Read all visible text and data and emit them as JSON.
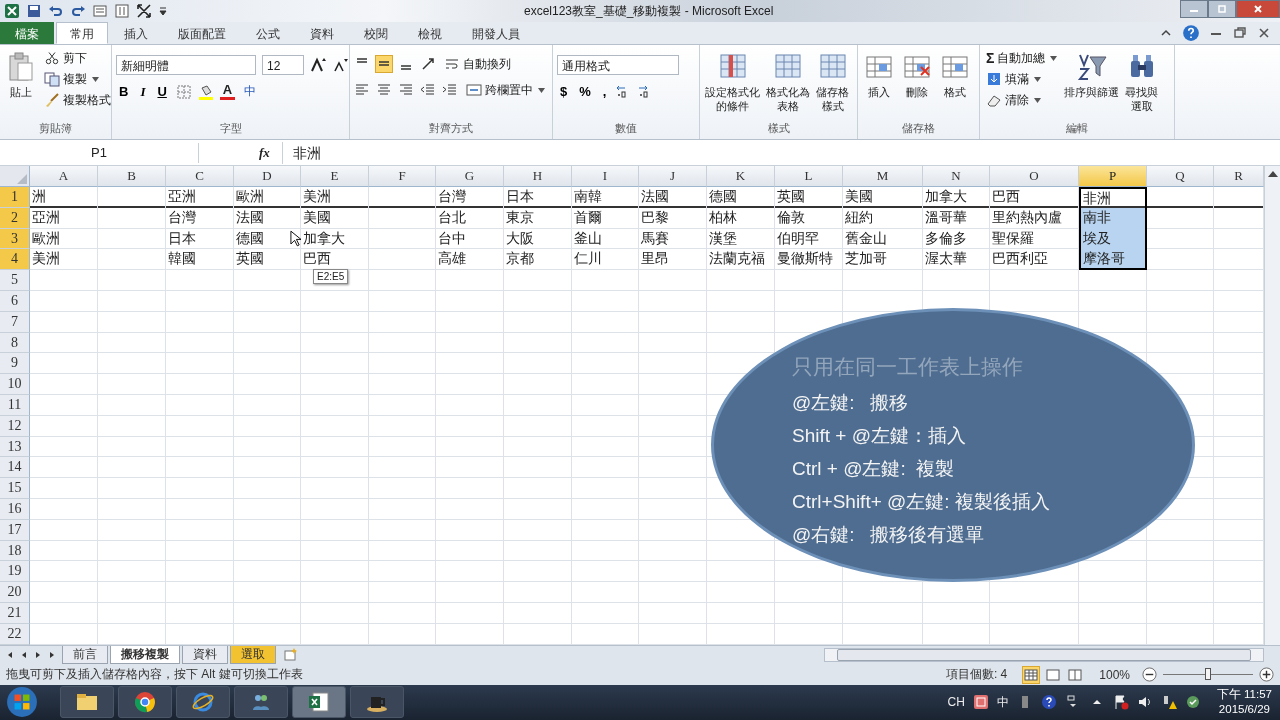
{
  "window": {
    "title": "excel123教室_基礎_移動複製 - Microsoft Excel"
  },
  "ribbon_tabs": [
    {
      "label": "檔案",
      "kind": "file",
      "selected": false
    },
    {
      "label": "常用",
      "kind": "tab",
      "selected": true
    },
    {
      "label": "插入",
      "kind": "tab",
      "selected": false
    },
    {
      "label": "版面配置",
      "kind": "tab",
      "selected": false
    },
    {
      "label": "公式",
      "kind": "tab",
      "selected": false
    },
    {
      "label": "資料",
      "kind": "tab",
      "selected": false
    },
    {
      "label": "校閱",
      "kind": "tab",
      "selected": false
    },
    {
      "label": "檢視",
      "kind": "tab",
      "selected": false
    },
    {
      "label": "開發人員",
      "kind": "tab",
      "selected": false
    }
  ],
  "ribbon": {
    "clipboard": {
      "label": "剪貼簿",
      "paste": "貼上",
      "cut": "剪下",
      "copy": "複製",
      "format_painter": "複製格式"
    },
    "font": {
      "label": "字型",
      "font_name": "新細明體",
      "font_size": "12",
      "bold": "B",
      "italic": "I",
      "underline": "U",
      "font_color": "A",
      "phonetic": "中"
    },
    "alignment": {
      "label": "對齊方式",
      "vertical": [
        {
          "selected": false
        },
        {
          "selected": true
        },
        {
          "selected": false
        }
      ],
      "wrap": "自動換列",
      "merge": "跨欄置中"
    },
    "number": {
      "label": "數值",
      "format": "通用格式",
      "currency": "$",
      "percent": "%",
      "comma": ","
    },
    "styles": {
      "label": "樣式",
      "buttons": [
        {
          "lines": [
            "設定格式化",
            "的條件"
          ]
        },
        {
          "lines": [
            "格式化為",
            "表格"
          ]
        },
        {
          "lines": [
            "儲存格",
            "樣式"
          ]
        }
      ]
    },
    "cells": {
      "label": "儲存格",
      "buttons": [
        "插入",
        "刪除",
        "格式"
      ]
    },
    "editing": {
      "label": "編輯",
      "sum_symbol": "Σ",
      "autosum": "自動加總",
      "fill": "填滿",
      "clear": "清除",
      "sort": "排序與篩選",
      "find": [
        "尋找與",
        "選取"
      ]
    }
  },
  "formula_bar": {
    "name_box": "P1",
    "fx": "fx",
    "formula": "非洲"
  },
  "grid": {
    "columns": [
      {
        "label": "A",
        "selected": false
      },
      {
        "label": "B",
        "selected": false
      },
      {
        "label": "C",
        "selected": false
      },
      {
        "label": "D",
        "selected": false
      },
      {
        "label": "E",
        "selected": false
      },
      {
        "label": "F",
        "selected": false
      },
      {
        "label": "G",
        "selected": false
      },
      {
        "label": "H",
        "selected": false
      },
      {
        "label": "I",
        "selected": false
      },
      {
        "label": "J",
        "selected": false
      },
      {
        "label": "K",
        "selected": false
      },
      {
        "label": "L",
        "selected": false
      },
      {
        "label": "M",
        "selected": false
      },
      {
        "label": "N",
        "selected": false
      },
      {
        "label": "O",
        "selected": false
      },
      {
        "label": "P",
        "selected": true
      },
      {
        "label": "Q",
        "selected": false
      },
      {
        "label": "R",
        "selected": false
      }
    ],
    "rows": [
      {
        "number": "1",
        "selected": true,
        "cells": [
          {
            "text": "洲",
            "selected": false
          },
          {
            "selected": false
          },
          {
            "text": "亞洲",
            "selected": false
          },
          {
            "text": "歐洲",
            "selected": false
          },
          {
            "text": "美洲",
            "selected": false
          },
          {
            "selected": false
          },
          {
            "text": "台灣",
            "selected": false
          },
          {
            "text": "日本",
            "selected": false
          },
          {
            "text": "南韓",
            "selected": false
          },
          {
            "text": "法國",
            "selected": false
          },
          {
            "text": "德國",
            "selected": false
          },
          {
            "text": "英國",
            "selected": false
          },
          {
            "text": "美國",
            "selected": false
          },
          {
            "text": "加拿大",
            "selected": false
          },
          {
            "text": "巴西",
            "selected": false
          },
          {
            "text": "非洲",
            "selected": true
          },
          {
            "selected": false
          },
          {
            "selected": false
          }
        ]
      },
      {
        "number": "2",
        "selected": true,
        "cells": [
          {
            "text": "亞洲",
            "selected": false
          },
          {
            "selected": false
          },
          {
            "text": "台灣",
            "selected": false
          },
          {
            "text": "法國",
            "selected": false
          },
          {
            "text": "美國",
            "selected": false
          },
          {
            "selected": false
          },
          {
            "text": "台北",
            "selected": false
          },
          {
            "text": "東京",
            "selected": false
          },
          {
            "text": "首爾",
            "selected": false
          },
          {
            "text": "巴黎",
            "selected": false
          },
          {
            "text": "柏林",
            "selected": false
          },
          {
            "text": "倫敦",
            "selected": false
          },
          {
            "text": "紐約",
            "selected": false
          },
          {
            "text": "溫哥華",
            "selected": false
          },
          {
            "text": "里約熱內盧",
            "selected": false
          },
          {
            "text": "南非",
            "selected": true
          },
          {
            "selected": false
          },
          {
            "selected": false
          }
        ]
      },
      {
        "number": "3",
        "selected": true,
        "cells": [
          {
            "text": "歐洲",
            "selected": false
          },
          {
            "selected": false
          },
          {
            "text": "日本",
            "selected": false
          },
          {
            "text": "德國",
            "selected": false
          },
          {
            "text": "加拿大",
            "selected": false
          },
          {
            "selected": false
          },
          {
            "text": "台中",
            "selected": false
          },
          {
            "text": "大阪",
            "selected": false
          },
          {
            "text": "釜山",
            "selected": false
          },
          {
            "text": "馬賽",
            "selected": false
          },
          {
            "text": "漢堡",
            "selected": false
          },
          {
            "text": "伯明罕",
            "selected": false
          },
          {
            "text": "舊金山",
            "selected": false
          },
          {
            "text": "多倫多",
            "selected": false
          },
          {
            "text": "聖保羅",
            "selected": false
          },
          {
            "text": "埃及",
            "selected": true
          },
          {
            "selected": false
          },
          {
            "selected": false
          }
        ]
      },
      {
        "number": "4",
        "selected": true,
        "cells": [
          {
            "text": "美洲",
            "selected": false
          },
          {
            "selected": false
          },
          {
            "text": "韓國",
            "selected": false
          },
          {
            "text": "英國",
            "selected": false
          },
          {
            "text": "巴西",
            "selected": false
          },
          {
            "selected": false
          },
          {
            "text": "高雄",
            "selected": false
          },
          {
            "text": "京都",
            "selected": false
          },
          {
            "text": "仁川",
            "selected": false
          },
          {
            "text": "里昂",
            "selected": false
          },
          {
            "text": "法蘭克福",
            "selected": false
          },
          {
            "text": "曼徹斯特",
            "selected": false
          },
          {
            "text": "芝加哥",
            "selected": false
          },
          {
            "text": "渥太華",
            "selected": false
          },
          {
            "text": "巴西利亞",
            "selected": false
          },
          {
            "text": "摩洛哥",
            "selected": true
          },
          {
            "selected": false
          },
          {
            "selected": false
          }
        ]
      },
      {
        "number": "5",
        "selected": false
      },
      {
        "number": "6",
        "selected": false
      },
      {
        "number": "7",
        "selected": false
      },
      {
        "number": "8",
        "selected": false
      },
      {
        "number": "9",
        "selected": false
      },
      {
        "number": "10",
        "selected": false
      },
      {
        "number": "11",
        "selected": false
      },
      {
        "number": "12",
        "selected": false
      },
      {
        "number": "13",
        "selected": false
      },
      {
        "number": "14",
        "selected": false
      },
      {
        "number": "15",
        "selected": false
      },
      {
        "number": "16",
        "selected": false
      },
      {
        "number": "17",
        "selected": false
      },
      {
        "number": "18",
        "selected": false
      },
      {
        "number": "19",
        "selected": false
      },
      {
        "number": "20",
        "selected": false
      },
      {
        "number": "21",
        "selected": false
      },
      {
        "number": "22",
        "selected": false
      }
    ],
    "drag_tooltip": "E2:E5"
  },
  "callout": {
    "title": "只用在同一工作表上操作",
    "lines": [
      "@左鍵:   搬移",
      "Shift + @左鍵：插入",
      "Ctrl + @左鍵:  複製",
      "Ctrl+Shift+ @左鍵: 複製後插入",
      "@右鍵:   搬移後有選單"
    ]
  },
  "sheet_tabs": [
    {
      "label": "前言",
      "selected": false
    },
    {
      "label": "搬移複製",
      "selected": true
    },
    {
      "label": "資料",
      "selected": false
    },
    {
      "label": "選取",
      "selected": false,
      "color": "#f2c230"
    }
  ],
  "status_bar": {
    "message": "拖曳可剪下及插入儲存格內容，按下 Alt 鍵可切換工作表",
    "count": "項目個數: 4",
    "views": [
      {
        "selected": true
      },
      {
        "selected": false
      },
      {
        "selected": false
      }
    ],
    "zoom": "100%",
    "zoom_level": {
      "level": 0.5
    }
  },
  "taskbar": {
    "language": "CH",
    "ime": "中",
    "time": "下午 11:57",
    "date": "2015/6/29"
  }
}
